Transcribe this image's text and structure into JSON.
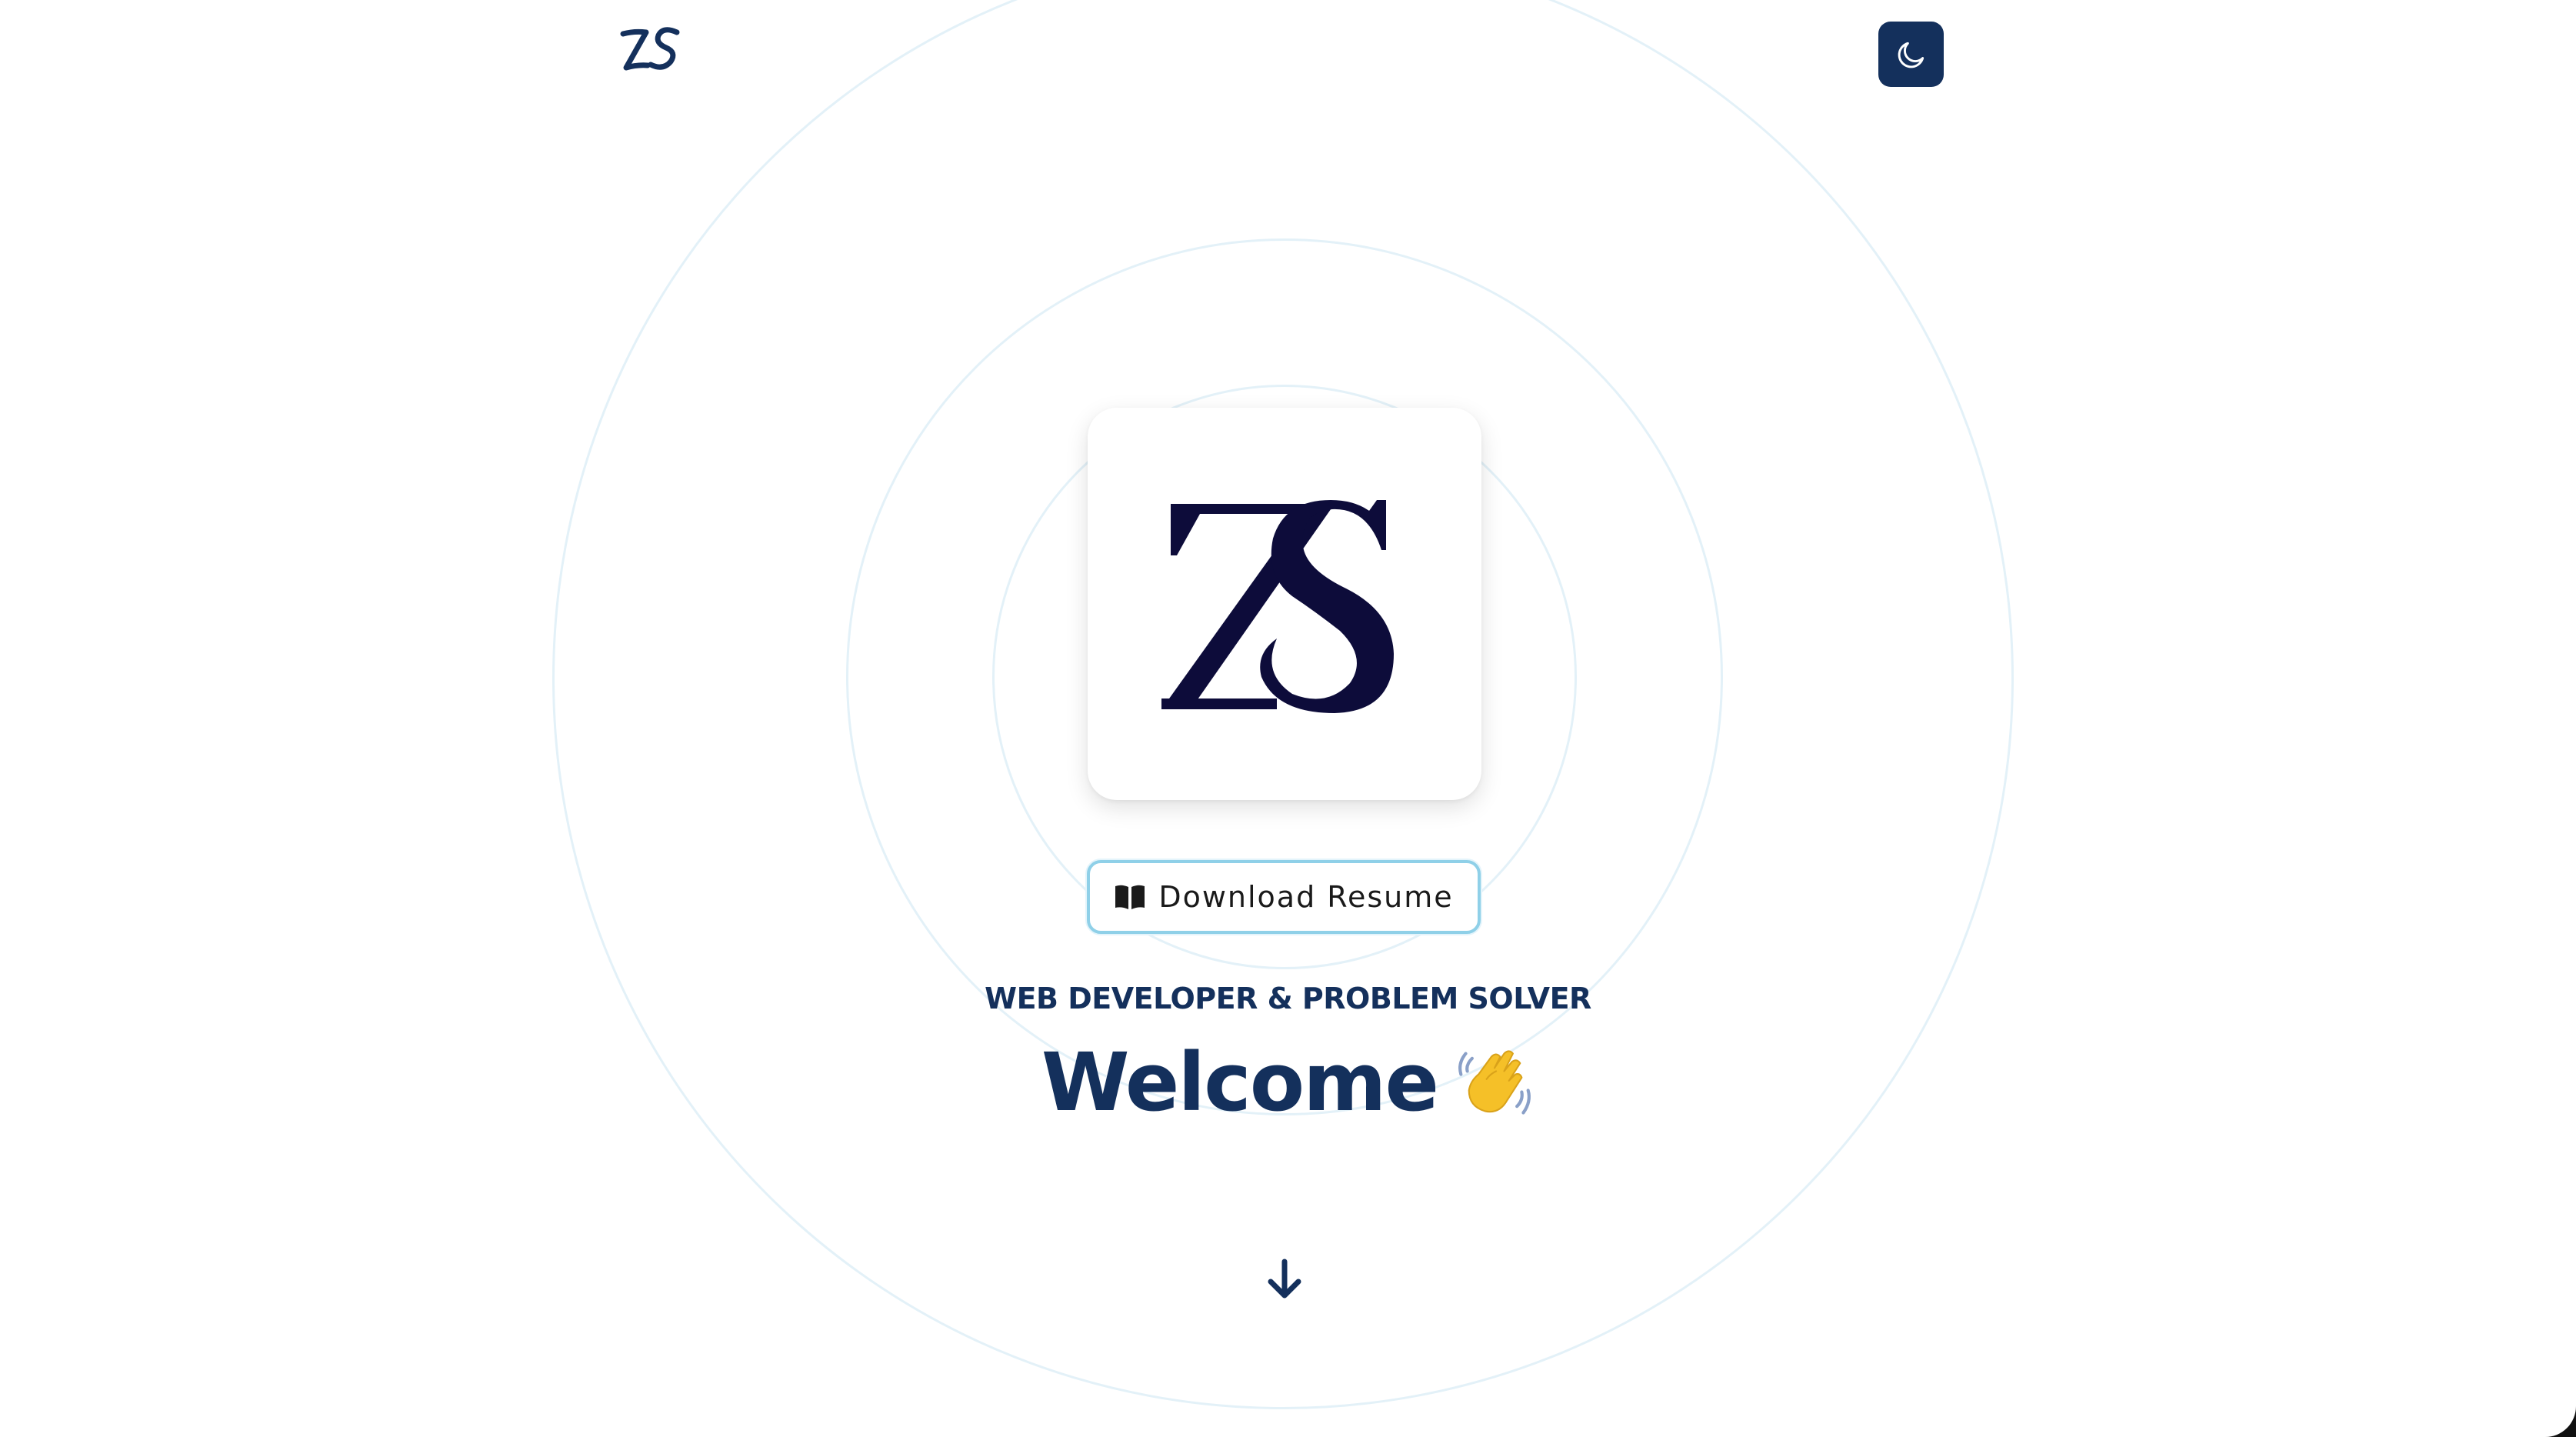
{
  "header": {
    "logo_icon": "zs-script-logo-icon",
    "theme_toggle_icon": "moon-icon"
  },
  "hero": {
    "logo_card_icon": "zs-monogram-logo-icon",
    "resume_button": {
      "icon": "open-book-icon",
      "label": "Download Resume"
    },
    "subtitle": "WEB DEVELOPER & PROBLEM SOLVER",
    "welcome": "Welcome",
    "welcome_icon": "waving-hand-icon",
    "scroll_icon": "arrow-down-icon"
  },
  "colors": {
    "brand_navy": "#14305c",
    "logo_dark": "#0d0c3a",
    "ring": "#e3f1f8",
    "button_border": "#8fd0e8",
    "background": "#ffffff"
  }
}
